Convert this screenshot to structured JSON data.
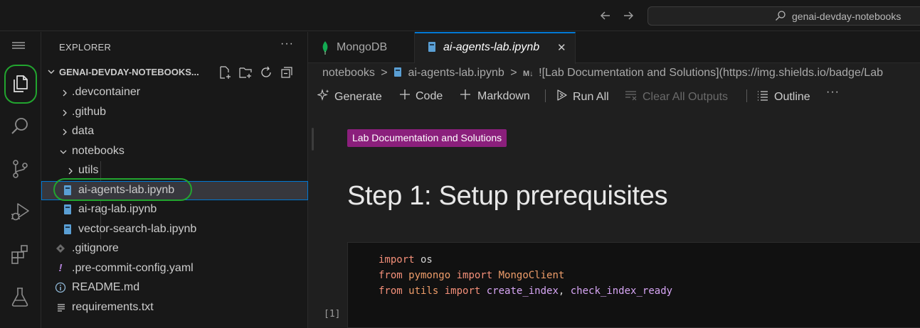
{
  "titlebar": {
    "back_icon": "arrow-left-icon",
    "forward_icon": "arrow-right-icon",
    "search_text": "genai-devday-notebooks"
  },
  "activity": [
    "files-icon",
    "search-icon",
    "source-control-icon",
    "run-debug-icon",
    "extensions-icon",
    "testing-icon"
  ],
  "sidebar": {
    "title": "EXPLORER",
    "more": "···",
    "section": "GENAI-DEVDAY-NOTEBOOKS...",
    "tree": [
      {
        "label": ".devcontainer"
      },
      {
        "label": ".github"
      },
      {
        "label": "data"
      },
      {
        "label": "notebooks"
      },
      {
        "label": "utils"
      },
      {
        "label": "ai-agents-lab.ipynb"
      },
      {
        "label": "ai-rag-lab.ipynb"
      },
      {
        "label": "vector-search-lab.ipynb"
      },
      {
        "label": ".gitignore"
      },
      {
        "label": ".pre-commit-config.yaml"
      },
      {
        "label": "README.md"
      },
      {
        "label": "requirements.txt"
      }
    ]
  },
  "tabs": [
    {
      "label": "MongoDB"
    },
    {
      "label": "ai-agents-lab.ipynb",
      "close": "✕"
    }
  ],
  "breadcrumb": {
    "folder": "notebooks",
    "sep": ">",
    "file": "ai-agents-lab.ipynb",
    "md_tag": "M↓",
    "symbol": "![Lab Documentation and Solutions](https://img.shields.io/badge/Lab"
  },
  "toolbar": {
    "generate": "Generate",
    "code": "Code",
    "markdown": "Markdown",
    "run_all": "Run All",
    "clear_all": "Clear All Outputs",
    "outline": "Outline",
    "more": "···"
  },
  "notebook": {
    "badge": "Lab Documentation and Solutions",
    "badge_color": "#8b1f7c",
    "heading": "Step 1: Setup prerequisites",
    "code": {
      "line1_kw": "import",
      "line1_mod": " os",
      "line2_kw": "from",
      "line2_mod": " pymongo",
      "line2_kw2": " import",
      "line2_name": " MongoClient",
      "line3_kw": "from",
      "line3_mod": " utils",
      "line3_kw2": " import",
      "line3_fn1": " create_index",
      "line3_comma": ",",
      "line3_fn2": " check_index_ready"
    },
    "exec_count": "[1]"
  },
  "colors": {
    "accent": "#0078d4",
    "highlight_ring": "#22a52f"
  }
}
